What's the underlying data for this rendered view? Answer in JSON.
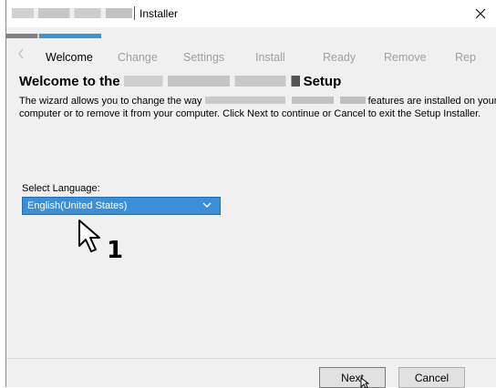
{
  "window": {
    "title": "Installer",
    "close_icon": "close-icon"
  },
  "progress": {
    "completed_fraction": 0.33
  },
  "steps": [
    {
      "label": "Welcome",
      "active": true
    },
    {
      "label": "Change",
      "active": false
    },
    {
      "label": "Settings",
      "active": false
    },
    {
      "label": "Install",
      "active": false
    },
    {
      "label": "Ready",
      "active": false
    },
    {
      "label": "Remove",
      "active": false
    },
    {
      "label": "Rep",
      "active": false
    }
  ],
  "heading": {
    "prefix": "Welcome to the",
    "suffix": "Setup"
  },
  "description": {
    "part1": "The wizard allows you to change the way",
    "part2": "features are installed on your computer or to remove it from your computer. Click Next to continue or Cancel to exit the Setup Installer."
  },
  "language": {
    "label": "Select Language:",
    "selected": "English(United States)"
  },
  "callout": {
    "number": "1"
  },
  "buttons": {
    "next": "Next",
    "cancel": "Cancel"
  },
  "colors": {
    "accent": "#3b8fd9",
    "progress_blue": "#3c93da",
    "window_bg": "#f0f0f0"
  }
}
